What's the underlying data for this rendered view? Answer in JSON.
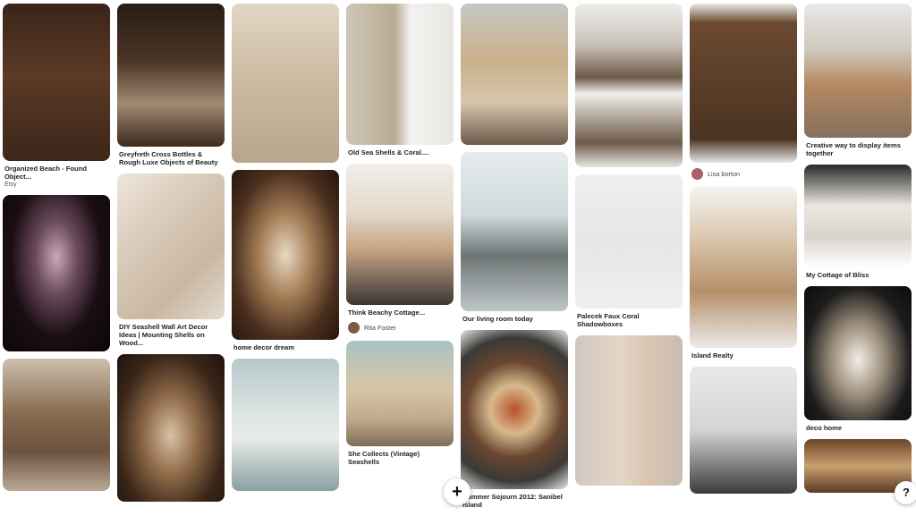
{
  "columns": [
    {
      "pins": [
        {
          "height": 176,
          "bg": "linear-gradient(180deg,#3a2418 0%,#5b3a26 45%,#3d2619 100%)",
          "title": "Organized Beach - Found Object...",
          "subtitle": "Etsy"
        },
        {
          "height": 175,
          "bg": "radial-gradient(ellipse at 50% 40%,#c9a8b8 0%,#6a4a5a 28%,#1a0e14 60%,#0d0608 100%)"
        },
        {
          "height": 148,
          "bg": "linear-gradient(180deg,#cdbfae 0%,#8a6e52 40%,#6d5240 70%,#b9a995 100%)"
        }
      ]
    },
    {
      "pins": [
        {
          "height": 160,
          "bg": "linear-gradient(180deg,#2a1c14 0%,#4a3526 40%,#a08a72 70%,#3c2a1e 100%)",
          "title": "Greyfreth Cross Bottles & Rough Luxe Objects of Beauty"
        },
        {
          "height": 163,
          "bg": "linear-gradient(135deg,#eee6dc 0%,#d6c8b6 40%,#c9b7a2 70%,#e5dbcf 100%)",
          "title": "DIY Seashell Wall Art Decor Ideas | Mounting Shells on Wood..."
        },
        {
          "height": 165,
          "bg": "radial-gradient(ellipse at 50% 55%,#d8c2a6 0%,#8f6a48 35%,#3a2618 70%,#1e130c 100%)"
        }
      ]
    },
    {
      "pins": [
        {
          "height": 178,
          "bg": "linear-gradient(180deg,#e2d6c4 0%,#cbb9a0 50%,#b8a68c 100%)"
        },
        {
          "height": 190,
          "bg": "radial-gradient(ellipse at 50% 50%,#e9d9c4 0%,#a57d56 35%,#4a2f1e 70%,#25160d 100%)",
          "title": "home decor dream"
        },
        {
          "height": 148,
          "bg": "linear-gradient(180deg,#b8c7c9 0%,#dbe3e2 40%,#e9ece8 60%,#8aa0a4 100%)"
        }
      ]
    },
    {
      "pins": [
        {
          "height": 158,
          "bg": "linear-gradient(90deg,#cfc6b6 0%,#b9ab95 45%,#f2f2f0 60%,#e8e6e2 100%)",
          "title": "Old Sea Shells & Coral...."
        },
        {
          "height": 158,
          "bg": "linear-gradient(180deg,#f1eee9 0%,#e3d9cb 35%,#c7a686 60%,#3d3733 100%)",
          "title": "Think Beachy Cottage...",
          "user": {
            "name": "Rita Foster",
            "avatar_color": "#7c5c48"
          }
        },
        {
          "height": 118,
          "bg": "linear-gradient(180deg,#a7c4c4 0%,#d8c6a8 45%,#bfa98c 75%,#7e6c5a 100%)",
          "title": "She Collects (Vintage) Seashells"
        }
      ]
    },
    {
      "pins": [
        {
          "height": 158,
          "bg": "linear-gradient(180deg,#c6c8c4 0%,#c9b08a 40%,#d7c6ad 70%,#6b5a4a 100%)"
        },
        {
          "height": 178,
          "bg": "linear-gradient(180deg,#e6ecee 0%,#cfd8db 40%,#6d7474 65%,#bfc6c8 100%)",
          "title": "Our living room today"
        },
        {
          "height": 178,
          "bg": "radial-gradient(circle at 50% 50%,#b8512a 0%,#d8b98c 25%,#6a4630 50%,#3a3a36 75%,#e8e8e4 100%)",
          "title": "Summer Sojourn 2012: Sanibel Island"
        }
      ]
    },
    {
      "pins": [
        {
          "height": 183,
          "bg": "linear-gradient(180deg,#eeeeec 0%,#c9c2b8 25%,#6d5a48 45%,#f1efeb 55%,#6d5a48 85%,#e8e6e2 100%)"
        },
        {
          "height": 150,
          "bg": "linear-gradient(180deg,#efefef 0%,#e6e6e6 50%,#efefef 100%)",
          "title": "Palecek Faux Coral Shadowboxes"
        },
        {
          "height": 168,
          "bg": "linear-gradient(90deg,#cfc8c0 0%,#e4d6c6 40%,#d9c4b0 70%,#c7bdb2 100%)"
        }
      ]
    },
    {
      "pins": [
        {
          "height": 178,
          "bg": "linear-gradient(180deg,#e7e7e5 0%,#6b4a30 12%,#4b3322 85%,#e7e7e5 100%)",
          "user": {
            "name": "Lisa borton",
            "avatar_color": "#a85f6a"
          }
        },
        {
          "height": 180,
          "bg": "linear-gradient(180deg,#f4f4f2 0%,#d7c2a6 35%,#b58f6a 65%,#ecebe8 100%)",
          "title": "Island Realty"
        },
        {
          "height": 142,
          "bg": "linear-gradient(180deg,#e9e9e9 0%,#d4d4d4 50%,#3b3b3b 100%)"
        }
      ]
    },
    {
      "pins": [
        {
          "height": 150,
          "bg": "linear-gradient(180deg,#e9e9e8 0%,#cfc8bc 35%,#b48a62 60%,#86705c 100%)",
          "title": "Creative way to display items together"
        },
        {
          "height": 115,
          "bg": "linear-gradient(180deg,#2a2a2a 0%,#ebe7e0 40%,#d9d3ca 70%,#ffffff 100%)",
          "title": "My Cottage of Bliss"
        },
        {
          "height": 150,
          "bg": "radial-gradient(ellipse at 50% 55%,#f3eee6 0%,#9a8c7a 35%,#1c1c1c 70%,#0b0b0b 100%)",
          "title": "deco home"
        },
        {
          "height": 60,
          "bg": "linear-gradient(180deg,#6b4628 0%,#c9a070 50%,#5a3b22 100%)"
        }
      ]
    }
  ],
  "fab": {
    "add_icon": "+",
    "help_icon": "?"
  }
}
